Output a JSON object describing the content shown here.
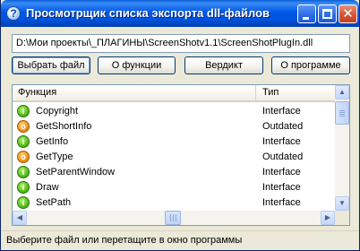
{
  "window": {
    "title": "Просмотрщик списка экспорта dll-файлов",
    "icon_name": "question-icon",
    "controls": {
      "minimize_icon": "minimize-icon",
      "maximize_icon": "maximize-icon",
      "close_icon": "close-icon"
    }
  },
  "path": {
    "value": "D:\\Мои проекты\\_ПЛАГИНЫ\\ScreenShotv1.1\\ScreenShotPlugIn.dll"
  },
  "toolbar": {
    "select_file": "Выбрать файл",
    "about_functions": "О функции",
    "verdict": "Вердикт",
    "about_program": "О программе"
  },
  "list": {
    "columns": [
      "Функция",
      "Тип"
    ],
    "rows": [
      {
        "icon": "interface-icon",
        "glyph": "i",
        "name": "Copyright",
        "type": "Interface"
      },
      {
        "icon": "outdated-icon",
        "glyph": "o",
        "name": "GetShortInfo",
        "type": "Outdated"
      },
      {
        "icon": "interface-icon",
        "glyph": "i",
        "name": "GetInfo",
        "type": "Interface"
      },
      {
        "icon": "outdated-icon",
        "glyph": "o",
        "name": "GetType",
        "type": "Outdated"
      },
      {
        "icon": "interface-icon",
        "glyph": "i",
        "name": "SetParentWindow",
        "type": "Interface"
      },
      {
        "icon": "interface-icon",
        "glyph": "i",
        "name": "Draw",
        "type": "Interface"
      },
      {
        "icon": "interface-icon",
        "glyph": "i",
        "name": "SetPath",
        "type": "Interface"
      }
    ]
  },
  "status": {
    "text": "Выберите файл или перетащите в окно программы"
  },
  "colors": {
    "titlebar": "#0054e3",
    "interface": "#5cc41c",
    "outdated": "#f39a1c"
  }
}
